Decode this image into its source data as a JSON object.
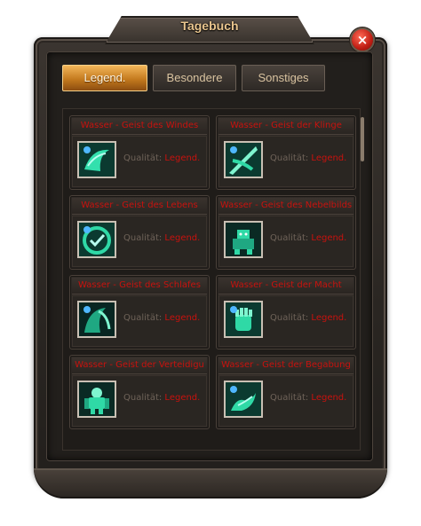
{
  "window": {
    "title": "Tagebuch",
    "close_symbol": "×"
  },
  "tabs": [
    {
      "label": "Legend.",
      "active": true
    },
    {
      "label": "Besondere",
      "active": false
    },
    {
      "label": "Sonstiges",
      "active": false
    }
  ],
  "quality_label": "Qualität:",
  "cards": [
    {
      "title": "Wasser - Geist des Windes",
      "quality": "Legend.",
      "icon": "wind-spirit-icon"
    },
    {
      "title": "Wasser - Geist der Klinge",
      "quality": "Legend.",
      "icon": "blade-spirit-icon"
    },
    {
      "title": "Wasser - Geist des Lebens",
      "quality": "Legend.",
      "icon": "life-spirit-icon"
    },
    {
      "title": "Wasser - Geist des Nebelbilds",
      "quality": "Legend.",
      "icon": "mist-golem-icon"
    },
    {
      "title": "Wasser - Geist des Schlafes",
      "quality": "Legend.",
      "icon": "sleep-spirit-icon"
    },
    {
      "title": "Wasser - Geist der Macht",
      "quality": "Legend.",
      "icon": "power-fist-icon"
    },
    {
      "title": "Wasser - Geist der Verteidigu",
      "quality": "Legend.",
      "icon": "defense-golem-icon"
    },
    {
      "title": "Wasser - Geist der Begabung",
      "quality": "Legend.",
      "icon": "talent-hand-icon"
    }
  ],
  "colors": {
    "title_gold": "#e9c58e",
    "active_tab": "#d98e2c",
    "legendary_red": "#c8120e",
    "icon_teal": "#2fd9a6"
  }
}
